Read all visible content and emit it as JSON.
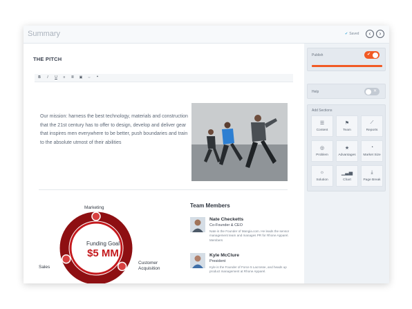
{
  "window": {
    "title": "Summary",
    "saved_label": "Saved",
    "prev": "‹",
    "next": "›"
  },
  "pitch": {
    "heading": "THE PITCH",
    "toolbar": [
      "B",
      "I",
      "U",
      "≡",
      "≣",
      "▣",
      "⇔",
      "❝"
    ],
    "mission": "Our mission: harness the best technology, materials and construction that the 21st century has to offer to design, develop and deliver gear that inspires men everywhere to be better, push boundaries and train to the absolute utmost of their abilities"
  },
  "chart_data": {
    "type": "pie",
    "title": "Funding Goal",
    "center_value": "$5 MM",
    "categories": [
      "Marketing",
      "Customer Acquisition",
      "Sales"
    ],
    "labels": {
      "marketing": "Marketing",
      "customer": "Customer",
      "acquisition": "Acquisition",
      "sales": "Sales"
    },
    "colors": [
      "#c4191d",
      "#8e0f12",
      "#d84040"
    ]
  },
  "team": {
    "heading": "Team Members",
    "members": [
      {
        "name": "Nate Checketts",
        "role": "Co-Founder & CEO",
        "bio": "Nate is the Founder of Mangia.com. He leads the sensor management team and manages PR for Rhone Apparel. Members"
      },
      {
        "name": "Kyle McClure",
        "role": "President",
        "bio": "Kyle is the Founder of Force 5 Lacrosse, and heads up product management at Rhone Apparel."
      }
    ]
  },
  "sidebar": {
    "publish": {
      "label": "Publish",
      "on": true,
      "color": "#f15a24"
    },
    "help": {
      "label": "Help",
      "on": false
    },
    "add_sections": {
      "label": "Add Sections",
      "tiles": [
        {
          "label": "Content",
          "icon": "☰"
        },
        {
          "label": "Team",
          "icon": "⚑"
        },
        {
          "label": "Reports",
          "icon": "⟋"
        },
        {
          "label": "Problem",
          "icon": "◎"
        },
        {
          "label": "Advantages",
          "icon": "★"
        },
        {
          "label": "Market Size",
          "icon": "◔"
        },
        {
          "label": "Solution",
          "icon": "☼"
        },
        {
          "label": "Chart",
          "icon": "▁▃▅"
        },
        {
          "label": "Page Break",
          "icon": "⤓"
        }
      ]
    }
  }
}
